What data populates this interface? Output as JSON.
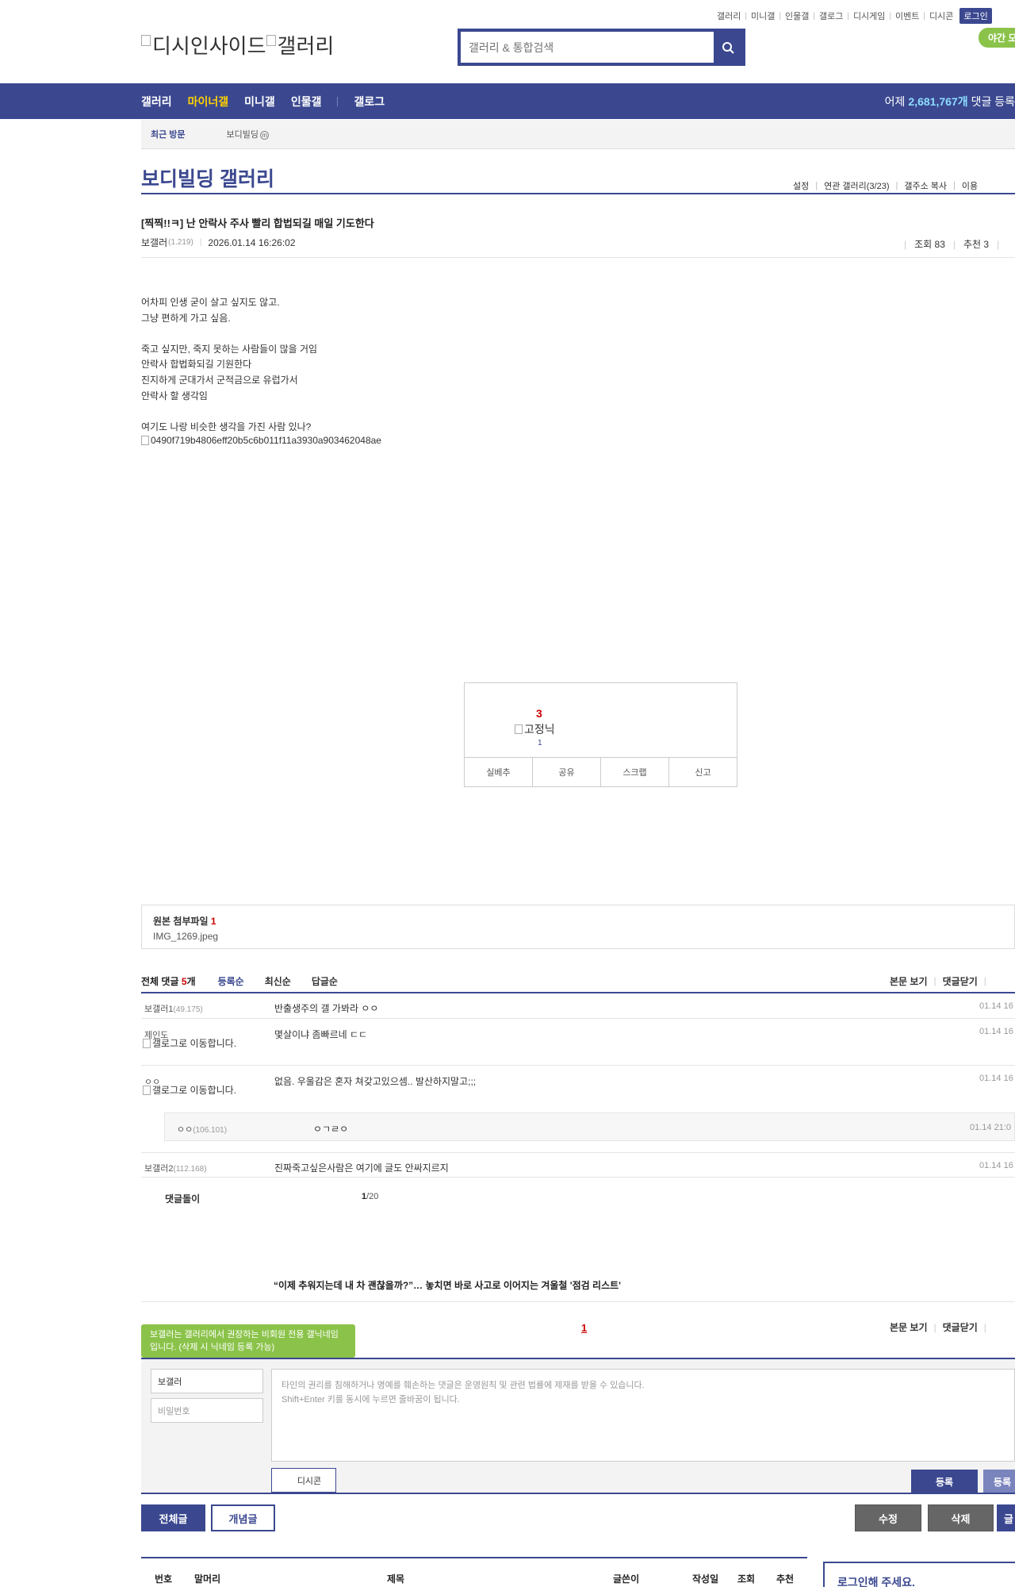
{
  "util_links": [
    "갤러리",
    "미니갤",
    "인물갤",
    "갤로그",
    "디시게임",
    "이벤트",
    "디시콘"
  ],
  "login_label": "로그인",
  "night_mode_label": "야간 모",
  "logo": {
    "part1": "디시인사이드",
    "part2": "갤러리"
  },
  "search": {
    "placeholder": "갤러리 & 통합검색"
  },
  "gnb": {
    "items": [
      "갤러리",
      "마이너갤",
      "미니갤",
      "인물갤",
      "갤로그"
    ],
    "active_index": 1,
    "stats_prefix": "어제",
    "stats_count": "2,681,767개",
    "stats_suffix": "댓글 등록"
  },
  "recent": {
    "title": "최근 방문",
    "item": "보디빌딩",
    "badge": "m"
  },
  "gallery": {
    "title": "보디빌딩 갤러리",
    "tools": [
      "설정",
      "연관 갤러리(3/23)",
      "갤주소 복사",
      "이용"
    ]
  },
  "post": {
    "title": "[찍찍!!ㅋ] 난 안락사 주사 빨리 합법되길 매일 기도한다",
    "author": "보갤러",
    "author_ip": "(1.219)",
    "date": "2026.01.14 16:26:02",
    "views_label": "조회 83",
    "recommend_label": "추천 3",
    "body": [
      "어차피 인생 굳이 살고 싶지도 않고.",
      "그냥 편하게 가고 싶음.",
      "",
      "죽고 싶지만, 죽지 못하는 사람들이 많을 거임",
      "안락사 합법화되길 기원한다",
      "진지하게 군대가서 군적금으로 유럽가서",
      "안락사 할 생각임",
      "",
      "여기도 나랑 비슷한 생각을 가진 사람 있나?"
    ],
    "image_alt": "0490f719b4806eff20b5c6b011f11a3930a903462048ae"
  },
  "recommend_box": {
    "count": "3",
    "fixed_label": "고정닉",
    "fixed_count": "1",
    "buttons": [
      "실베추",
      "공유",
      "스크랩",
      "신고"
    ]
  },
  "attachment": {
    "label": "원본 첨부파일",
    "count": "1",
    "file": "IMG_1269.jpeg"
  },
  "comments_header": {
    "total_label": "전체 댓글",
    "total_count": "5",
    "total_unit": "개",
    "sorts": [
      "등록순",
      "최신순",
      "답글순"
    ],
    "right": [
      "본문 보기",
      "댓글닫기"
    ]
  },
  "comments": [
    {
      "nick": "보갤러1",
      "ip": "(49.175)",
      "text": "반출생주의 갤 가봐라 ㅇㅇ",
      "date": "01.14 16"
    },
    {
      "nick": "제인도",
      "ip": "",
      "gallog": "갤로그로 이동합니다.",
      "text": "몇살이냐 좀빠르네 ㄷㄷ",
      "date": "01.14 16"
    },
    {
      "nick": "ㅇㅇ",
      "ip": "",
      "gallog": "갤로그로 이동합니다.",
      "text": "없음. 우울감은 혼자 쳐갖고있으셈.. 발산하지말고;;;",
      "date": "01.14 16"
    },
    {
      "nick": "보갤러2",
      "ip": "(112.168)",
      "text": "진짜죽고싶은사람은 여기에 글도 안싸지르지",
      "date": "01.14 16"
    }
  ],
  "reply": {
    "nick": "ㅇㅇ",
    "ip": "(106.101)",
    "text": "ㅇㄱㄹㅇ",
    "date": "01.14 21:0"
  },
  "cleanbot": "댓글돌이",
  "comment_page": {
    "current": "1",
    "total": "/20"
  },
  "ad_text": "“이제 추워지는데 내 차 괜찮을까?”… 놓치면 바로 사고로 이어지는 겨울철 '점검 리스트'",
  "pager": "1",
  "write": {
    "tooltip": "보갤러는 갤러리에서 권장하는 비회원 전용 갤닉네임입니다. (삭제 시 닉네임 등록 가능)",
    "name_value": "보갤러",
    "password_placeholder": "비밀번호",
    "textarea_line1": "타인의 권리를 침해하거나 명예를 훼손하는 댓글은 운영원칙 및 관련 법률에 제재를 받을 수 있습니다.",
    "textarea_line2": "Shift+Enter 키를 동시에 누르면 줄바꿈이 됩니다.",
    "dccon_label": "디시콘",
    "submit_label": "등록",
    "submit2_label": "등록"
  },
  "bottom_buttons": {
    "all": "전체글",
    "concept": "개념글",
    "edit": "수정",
    "delete": "삭제",
    "write": "글"
  },
  "list_head": [
    "번호",
    "말머리",
    "제목",
    "글쓴이",
    "작성일",
    "조회",
    "추천"
  ],
  "login_prompt": "로그인해 주세요."
}
